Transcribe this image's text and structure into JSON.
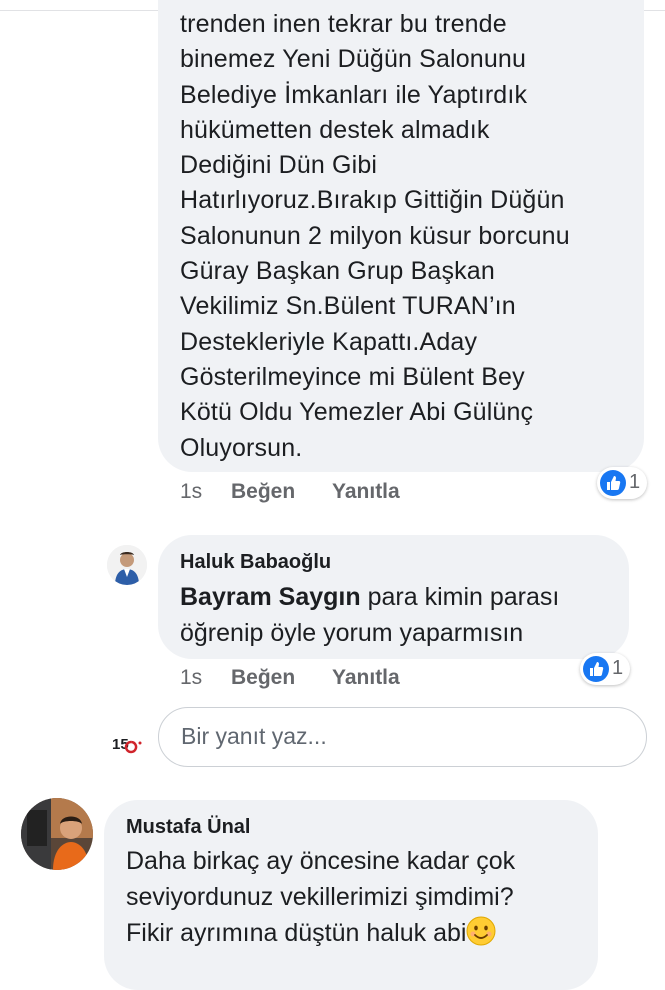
{
  "thread": {
    "comment1": {
      "text": "trenden inen tekrar bu trende\nbinemez Yeni Düğün Salonunu\nBelediye İmkanları ile Yaptırdık\nhükümetten destek almadık\nDediğini Dün Gibi\nHatırlıyoruz.Bırakıp Gittiğin Düğün\nSalonunun 2 milyon küsur borcunu\nGüray Başkan Grup Başkan\nVekilimiz Sn.Bülent TURAN’ın\nDestekleriyle Kapattı.Aday\nGösterilmeyince mi Bülent Bey\nKötü Oldu Yemezler Abi Gülünç\nOluyorsun.",
      "time": "1s",
      "like_label": "Beğen",
      "reply_label": "Yanıtla",
      "reaction_count": "1"
    },
    "comment2": {
      "author": "Haluk Babaoğlu",
      "mention": "Bayram Saygın",
      "text": " para kimin parası\nöğrenip öyle yorum yaparmısın",
      "time": "1s",
      "like_label": "Beğen",
      "reply_label": "Yanıtla",
      "reaction_count": "1"
    },
    "reply_input": {
      "placeholder": "Bir yanıt yaz...",
      "avatar_text": "15"
    },
    "comment3": {
      "author": "Mustafa Ünal",
      "text": "Daha birkaç ay öncesine kadar çok\nseviyordunuz vekillerimizi şimdimi?\nFikir ayrımına düştün haluk abi"
    }
  },
  "colors": {
    "bubble": "#f0f2f5",
    "like_blue": "#1877f2",
    "meta_gray": "#65676b",
    "text": "#1c1e21"
  },
  "icons": [
    "like-icon",
    "smile-emoji-icon"
  ]
}
